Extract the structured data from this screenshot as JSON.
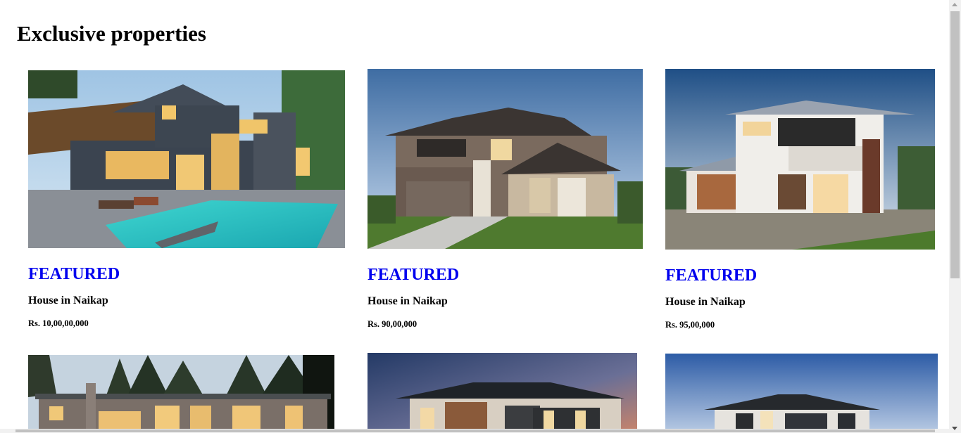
{
  "page": {
    "title": "Exclusive properties"
  },
  "listings": [
    {
      "badge": "FEATURED",
      "title": "House in Naikap",
      "price": "Rs. 10,00,00,000",
      "image": "modern-house-with-pool-photo"
    },
    {
      "badge": "FEATURED",
      "title": "House in Naikap",
      "price": "Rs. 90,00,000",
      "image": "two-storey-brick-house-photo"
    },
    {
      "badge": "FEATURED",
      "title": "House in Naikap",
      "price": "Rs. 95,00,000",
      "image": "white-modern-house-photo"
    },
    {
      "image": "flat-roof-house-forest-photo"
    },
    {
      "image": "hip-roof-house-dusk-photo"
    },
    {
      "image": "modern-house-blue-sky-photo"
    }
  ]
}
